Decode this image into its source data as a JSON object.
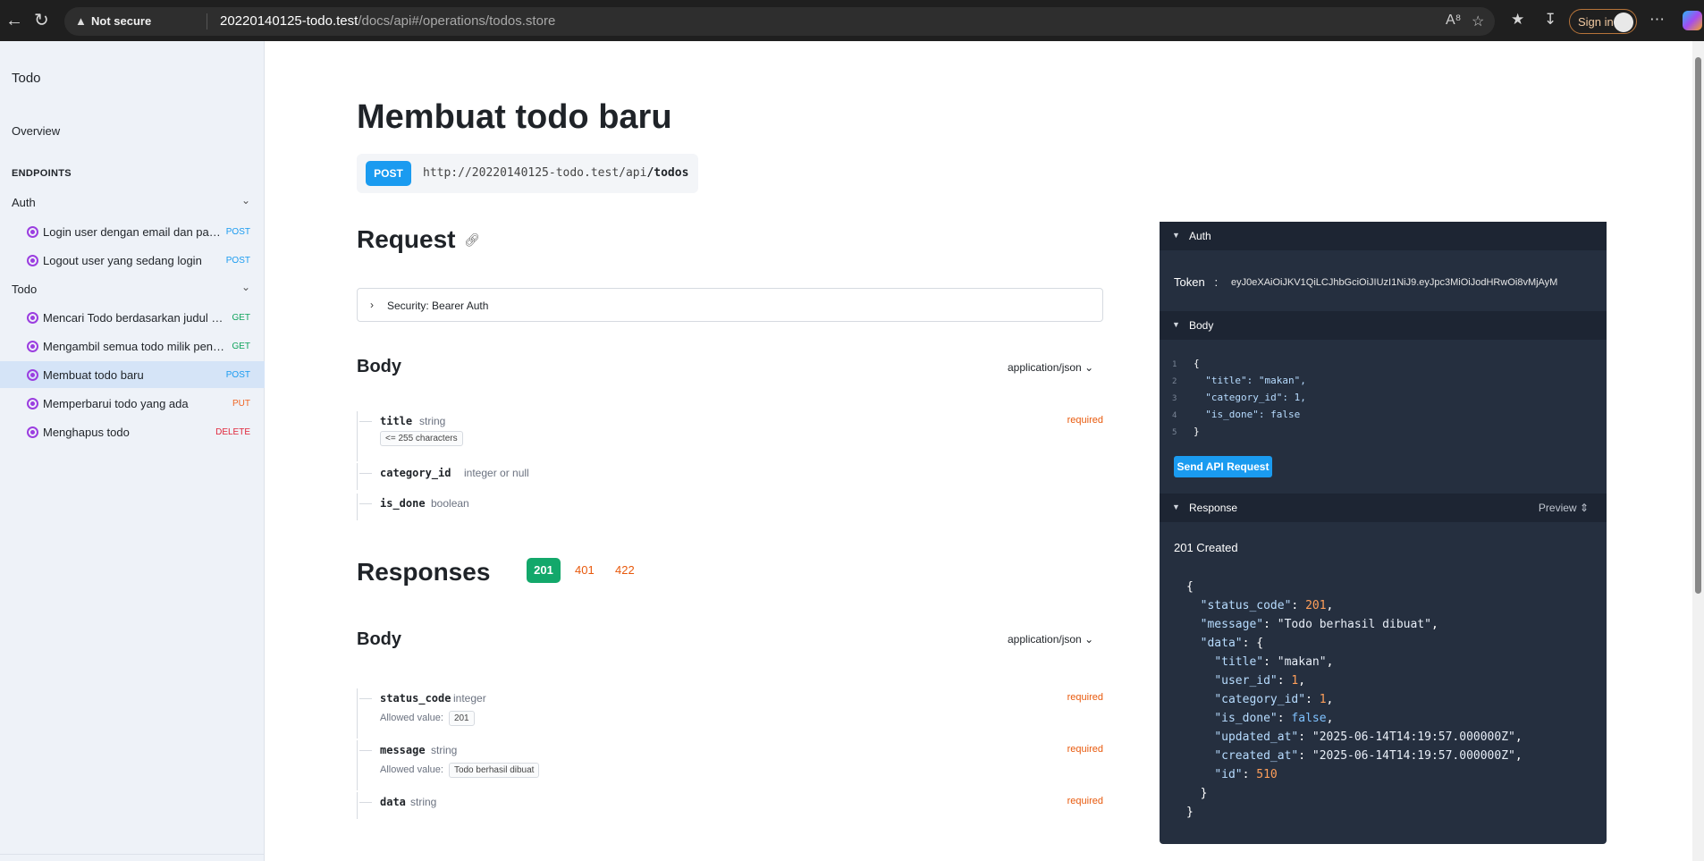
{
  "browser": {
    "not_secure": "Not secure",
    "url_host": "20220140125-todo.test",
    "url_path": "/docs/api#/operations/todos.store",
    "sign_in": "Sign in"
  },
  "sidebar": {
    "title": "Todo",
    "overview": "Overview",
    "endpoints_heading": "ENDPOINTS",
    "groups": [
      {
        "label": "Auth",
        "items": [
          {
            "label": "Login user dengan email dan passw...",
            "method": "POST"
          },
          {
            "label": "Logout user yang sedang login",
            "method": "POST"
          }
        ]
      },
      {
        "label": "Todo",
        "items": [
          {
            "label": "Mencari Todo berdasarkan judul atau...",
            "method": "GET"
          },
          {
            "label": "Mengambil semua todo milik penggu...",
            "method": "GET"
          },
          {
            "label": "Membuat todo baru",
            "method": "POST"
          },
          {
            "label": "Memperbarui todo yang ada",
            "method": "PUT"
          },
          {
            "label": "Menghapus todo",
            "method": "DELETE"
          }
        ]
      }
    ]
  },
  "main": {
    "title": "Membuat todo baru",
    "method": "POST",
    "url_base": "http://20220140125-todo.test/api",
    "url_path": "/todos",
    "request_heading": "Request",
    "security_label": "Security: Bearer Auth",
    "body_heading": "Body",
    "content_type": "application/json",
    "request_fields": [
      {
        "name": "title",
        "type": "string",
        "required": "required",
        "constraint": "<= 255 characters"
      },
      {
        "name": "category_id",
        "type": "integer or null"
      },
      {
        "name": "is_done",
        "type": "boolean"
      }
    ],
    "responses_heading": "Responses",
    "response_codes": [
      "201",
      "401",
      "422"
    ],
    "response_body_heading": "Body",
    "response_content_type": "application/json",
    "response_fields": [
      {
        "name": "status_code",
        "type": "integer",
        "required": "required",
        "allowed_label": "Allowed value:",
        "allowed": "201"
      },
      {
        "name": "message",
        "type": "string",
        "required": "required",
        "allowed_label": "Allowed value:",
        "allowed": "Todo berhasil dibuat"
      },
      {
        "name": "data",
        "type": "string",
        "required": "required"
      }
    ]
  },
  "panel": {
    "auth_label": "Auth",
    "token_label": "Token",
    "token_sep": ":",
    "token_value": "eyJ0eXAiOiJKV1QiLCJhbGciOiJIUzI1NiJ9.eyJpc3MiOiJodHRwOi8vMjAyM",
    "body_label": "Body",
    "body_lines": [
      "{",
      "  \"title\": \"makan\",",
      "  \"category_id\": 1,",
      "  \"is_done\": false",
      "}"
    ],
    "send_label": "Send API Request",
    "response_label": "Response",
    "preview_label": "Preview",
    "status_text": "201 Created",
    "response_json": {
      "status_code": 201,
      "message": "Todo berhasil dibuat",
      "data": {
        "title": "makan",
        "user_id": 1,
        "category_id": 1,
        "is_done": false,
        "updated_at": "2025-06-14T14:19:57.000000Z",
        "created_at": "2025-06-14T14:19:57.000000Z",
        "id": 510
      }
    }
  }
}
